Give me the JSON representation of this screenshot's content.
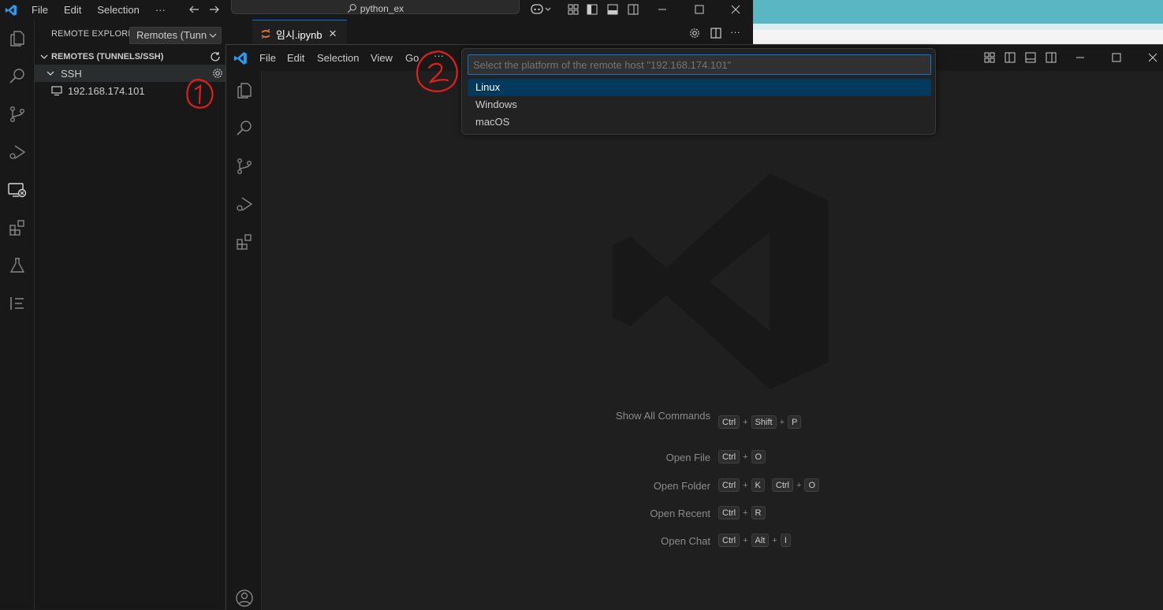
{
  "back_window": {
    "menu": [
      "File",
      "Edit",
      "Selection",
      "···"
    ],
    "search_box": "python_ex",
    "sidebar": {
      "title": "REMOTE EXPLORER",
      "dropdown_value": "Remotes (Tunn",
      "more": "···",
      "section_title": "REMOTES (TUNNELS/SSH)",
      "group_label": "SSH",
      "host_label": "192.168.174.101"
    },
    "tab": {
      "label": "임시.ipynb",
      "close": "✕"
    },
    "more": "···"
  },
  "front_window": {
    "menu": [
      "File",
      "Edit",
      "Selection",
      "View",
      "Go",
      "···"
    ],
    "quick_pick": {
      "placeholder": "Select the platform of the remote host \"192.168.174.101\"",
      "items": [
        "Linux",
        "Windows",
        "macOS"
      ],
      "selected_index": 0
    },
    "shortcuts": [
      {
        "label": "Show All Commands",
        "keys": [
          [
            "Ctrl",
            "Shift",
            "P"
          ]
        ]
      },
      {
        "label": "Open File",
        "keys": [
          [
            "Ctrl",
            "O"
          ]
        ]
      },
      {
        "label": "Open Folder",
        "keys": [
          [
            "Ctrl",
            "K"
          ],
          [
            "Ctrl",
            "O"
          ]
        ]
      },
      {
        "label": "Open Recent",
        "keys": [
          [
            "Ctrl",
            "R"
          ]
        ]
      },
      {
        "label": "Open Chat",
        "keys": [
          [
            "Ctrl",
            "Alt",
            "I"
          ]
        ]
      }
    ]
  },
  "colors": {
    "accent": "#0078d4",
    "selection": "#04395e",
    "annotation": "#e0201a"
  }
}
